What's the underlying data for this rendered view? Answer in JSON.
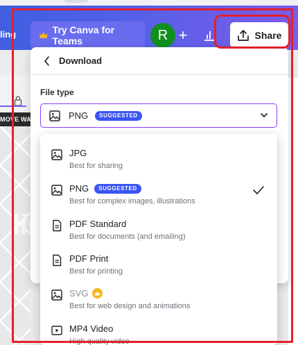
{
  "header": {
    "left_cut_text": "ling",
    "try_button": "Try Canva for Teams",
    "avatar_initial": "R",
    "share_label": "Share"
  },
  "canvas": {
    "band_text": "MOVE WAT",
    "big_glyph": "lin"
  },
  "download": {
    "title": "Download",
    "file_type_label": "File type",
    "selected_value": "PNG",
    "selected_badge": "SUGGESTED",
    "options": [
      {
        "name": "JPG",
        "desc": "Best for sharing",
        "icon": "image-icon"
      },
      {
        "name": "PNG",
        "badge": "SUGGESTED",
        "desc": "Best for complex images, illustrations",
        "icon": "image-icon",
        "selected": true
      },
      {
        "name": "PDF Standard",
        "desc": "Best for documents (and emailing)",
        "icon": "document-icon"
      },
      {
        "name": "PDF Print",
        "desc": "Best for printing",
        "icon": "document-icon"
      },
      {
        "name": "SVG",
        "desc": "Best for web design and animations",
        "icon": "image-icon",
        "pro": true
      },
      {
        "name": "MP4 Video",
        "desc": "High quality video",
        "icon": "video-icon"
      }
    ]
  },
  "colors": {
    "accent_purple": "#8b3dff",
    "badge_blue": "#3b54f5",
    "highlight_red": "#e3202b",
    "avatar_green": "#11901f",
    "pro_gold": "#f5b81c"
  }
}
